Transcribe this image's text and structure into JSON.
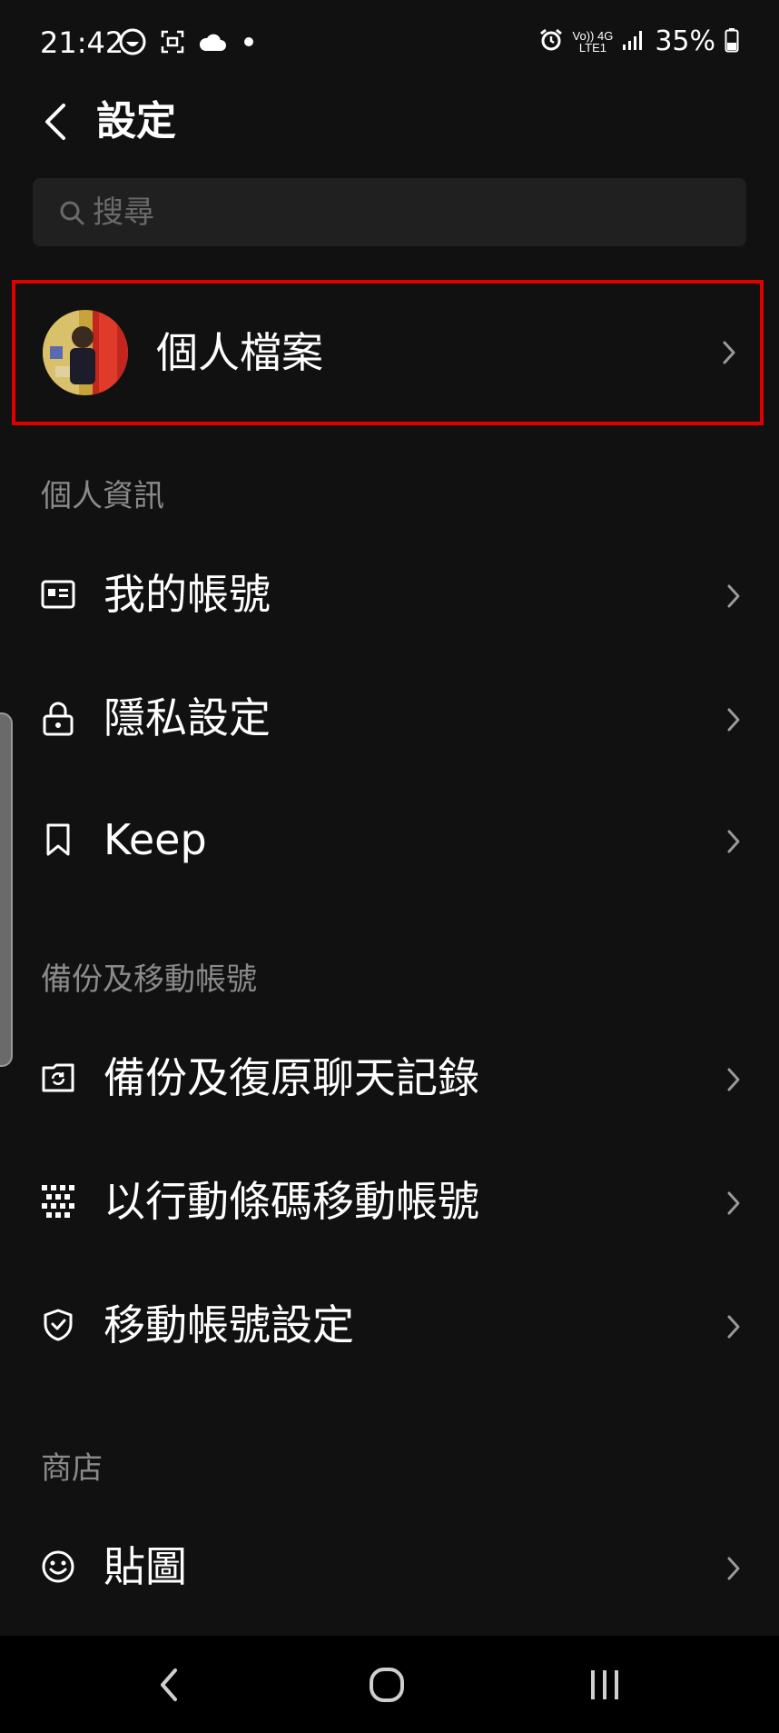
{
  "status_bar": {
    "time": "21:42",
    "network_top": "Vo)) 4G",
    "network_bottom": "LTE1",
    "battery": "35%",
    "icons": [
      "face-icon",
      "screenshot-icon",
      "cloud-icon",
      "dot-icon",
      "alarm-icon",
      "volte-icon",
      "signal-icon",
      "battery-icon"
    ]
  },
  "header": {
    "title": "設定",
    "back_icon": "chevron-left-icon"
  },
  "search": {
    "placeholder": "搜尋"
  },
  "profile": {
    "label": "個人檔案",
    "highlight_color": "#e00000"
  },
  "sections": {
    "personal": {
      "label": "個人資訊",
      "items": [
        {
          "label": "我的帳號",
          "icon": "id-card-icon"
        },
        {
          "label": "隱私設定",
          "icon": "lock-icon"
        },
        {
          "label": "Keep",
          "icon": "bookmark-icon"
        }
      ]
    },
    "backup": {
      "label": "備份及移動帳號",
      "items": [
        {
          "label": "備份及復原聊天記錄",
          "icon": "backup-icon"
        },
        {
          "label": "以行動條碼移動帳號",
          "icon": "qr-code-icon"
        },
        {
          "label": "移動帳號設定",
          "icon": "shield-icon"
        }
      ]
    },
    "store": {
      "label": "商店",
      "items": [
        {
          "label": "貼圖",
          "icon": "smiley-icon"
        }
      ]
    }
  },
  "nav_bar": {
    "icons": [
      "back-icon",
      "home-icon",
      "recents-icon"
    ]
  },
  "colors": {
    "background": "#111111",
    "text": "#ffffff",
    "section_label": "#8a8a8a",
    "search_bg": "#202020"
  }
}
